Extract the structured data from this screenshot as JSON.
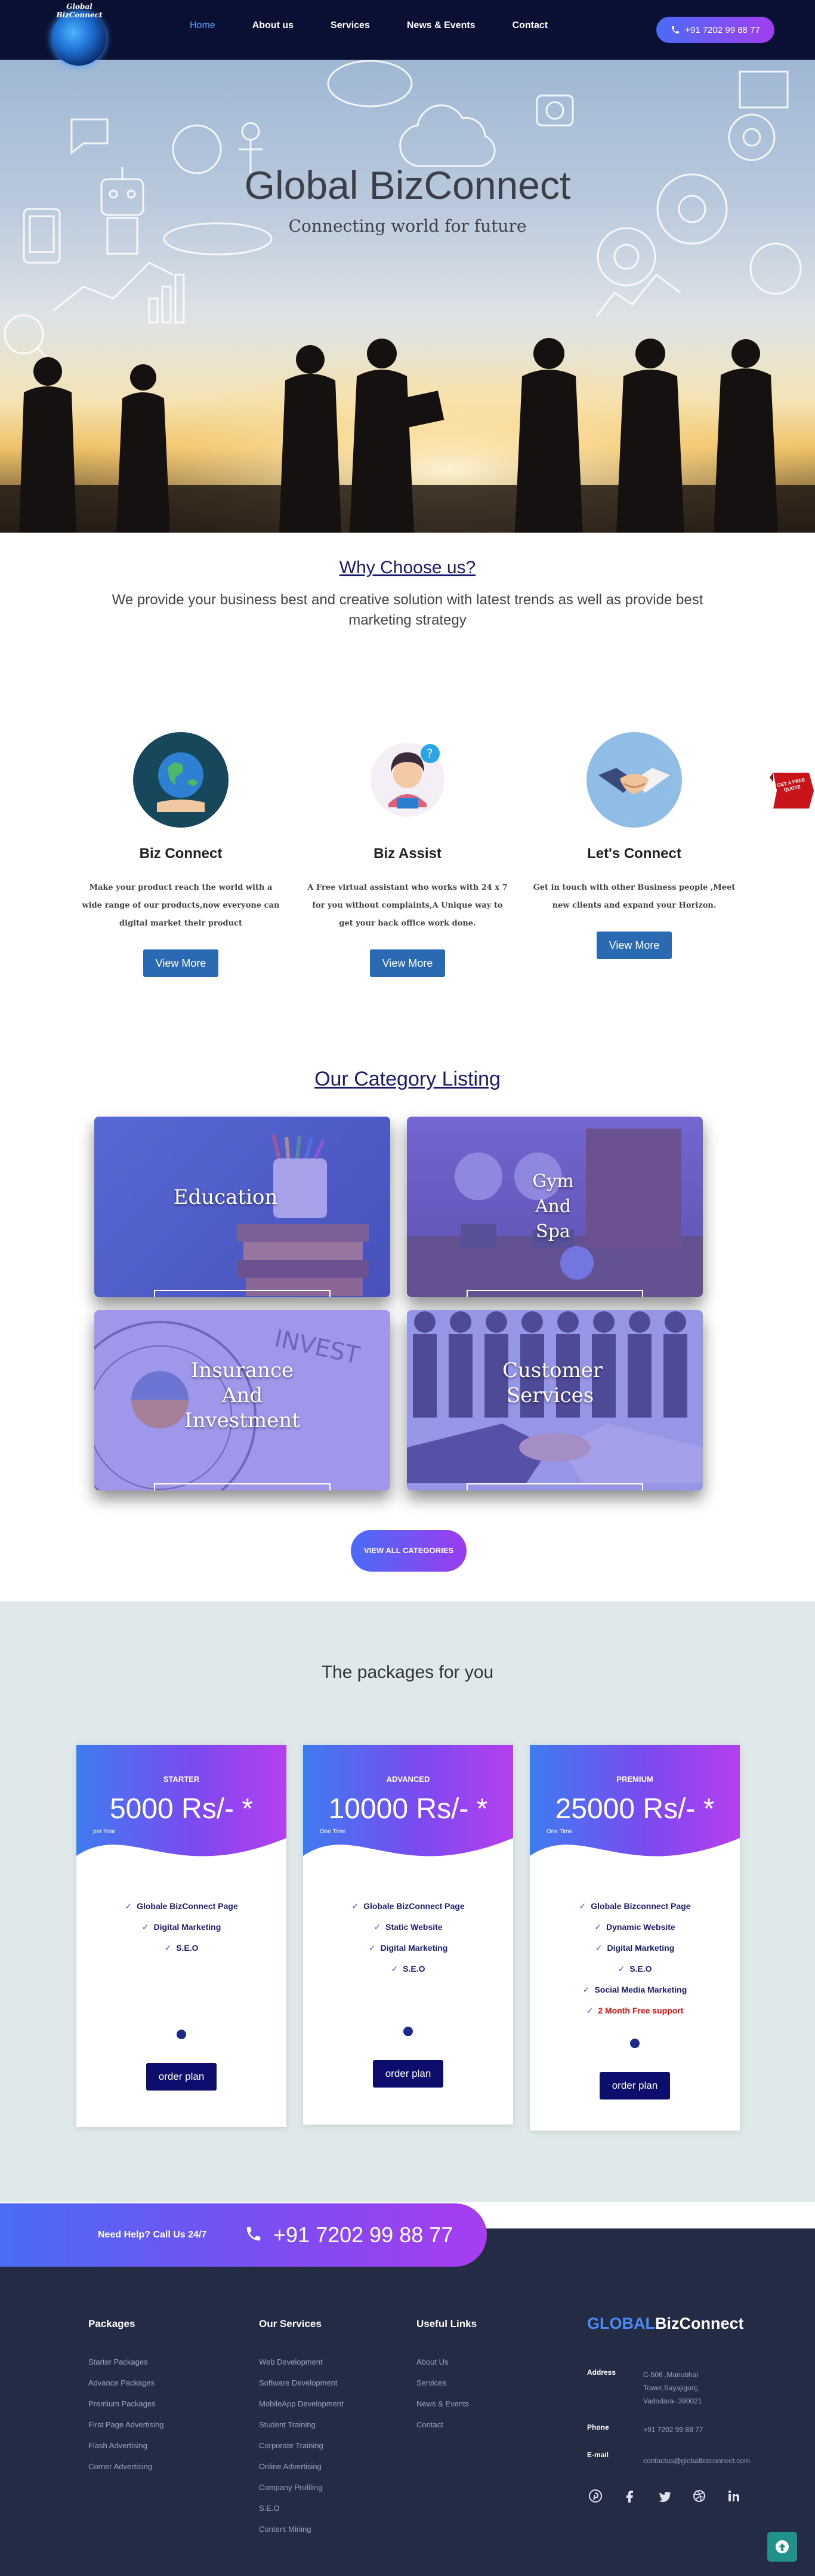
{
  "nav": {
    "logo_text": "Global BizConnect",
    "links": [
      "Home",
      "About us",
      "Services",
      "News & Events",
      "Contact"
    ],
    "phone": "+91 7202 99 88 77"
  },
  "hero": {
    "title": "Global BizConnect",
    "subtitle": "Connecting world for future"
  },
  "why": {
    "title": "Why Choose us?",
    "text": "We provide your business best and creative solution with latest trends as well as provide best marketing strategy"
  },
  "features": [
    {
      "title": "Biz Connect",
      "text": "Make your product reach the world with a wide range of our products,now everyone can digital market their product",
      "button": "View More"
    },
    {
      "title": "Biz Assist",
      "text": "A Free virtual assistant who works with 24 x 7 for you without complaints,A Unique way to get your back office work done.",
      "button": "View More"
    },
    {
      "title": "Let's Connect",
      "text": "Get in touch with other Business people ,Meet new clients and expand your Horizon.",
      "button": "View More"
    }
  ],
  "side_badge": "GET A FREE QUOTE",
  "categories": {
    "title": "Our Category Listing",
    "items": [
      "Education",
      "Gym And Spa",
      "Insurance And Investment",
      "Customer Services"
    ],
    "button": "VIEW ALL CATEGORIES"
  },
  "packages": {
    "title": "The packages for you",
    "plans": [
      {
        "tier": "STARTER",
        "price": "5000 Rs/- *",
        "per": "per Year",
        "features": [
          "Globale BizConnect Page",
          "Digital Marketing",
          "S.E.O"
        ],
        "button": "order plan"
      },
      {
        "tier": "ADVANCED",
        "price": "10000 Rs/- *",
        "per": "One Time",
        "features": [
          "Globale BizConnect Page",
          "Static Website",
          "Digital Marketing",
          "S.E.O"
        ],
        "button": "order plan"
      },
      {
        "tier": "PREMIUM",
        "price": "25000 Rs/- *",
        "per": "One Time",
        "features": [
          "Globale Bizconnect Page",
          "Dynamic Website",
          "Digital Marketing",
          "S.E.O",
          "Social Media Marketing",
          "2 Month Free support"
        ],
        "button": "order plan"
      }
    ]
  },
  "help": {
    "label": "Need Help? Call Us 24/7",
    "phone": "+91 7202 99 88 77"
  },
  "footer": {
    "packages": {
      "title": "Packages",
      "items": [
        "Starter Packages",
        "Advance Packages",
        "Premium Packages",
        "First Page Advertising",
        "Flash Advertising",
        "Corner Advertising"
      ]
    },
    "services": {
      "title": "Our Services",
      "items": [
        "Web Development",
        "Software Development",
        "MobileApp Development",
        "Student Training",
        "Corporate Training",
        "Online Advertising",
        "Company Profiling",
        "S.E.O",
        "Content Mining"
      ]
    },
    "useful": {
      "title": "Useful Links",
      "items": [
        "About Us",
        "Services",
        "News & Events",
        "Contact"
      ]
    },
    "brand_a": "GLOBAL",
    "brand_b": "BizConnect",
    "address_label": "Address",
    "address": "C-506 ,Manubhai Tower,Sayajigunj, Vadodara- 390021",
    "phone_label": "Phone",
    "phone": "+91 7202 99 88 77",
    "email_label": "E-mail",
    "email": "contactus@globalbizconnect.com",
    "socials": [
      "pinterest-icon",
      "facebook-icon",
      "twitter-icon",
      "dribbble-icon",
      "linkedin-icon"
    ]
  },
  "colors": {
    "nav_bg": "#0a1033",
    "accent_blue": "#2a6ab2",
    "gradient_start": "#4a6cf7",
    "gradient_end": "#a83cf0",
    "footer_bg": "#242b45"
  }
}
